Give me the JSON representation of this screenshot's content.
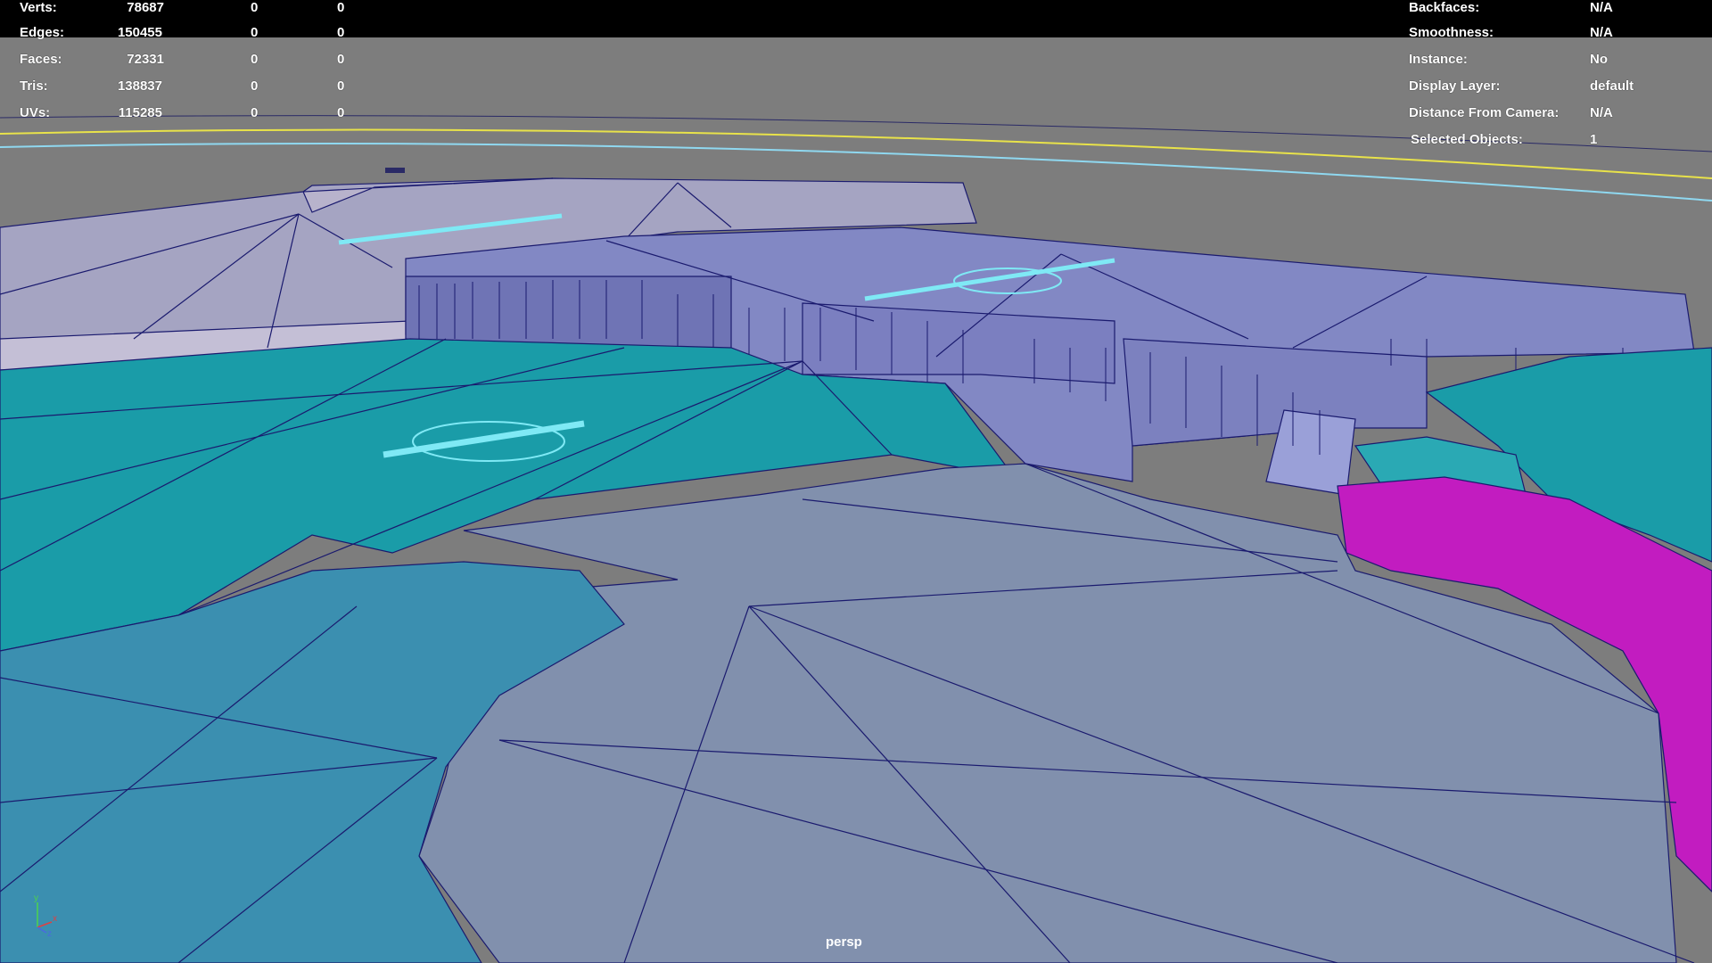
{
  "stats": [
    {
      "label": "Verts:",
      "total": "78687",
      "selected": "0",
      "extra": "0"
    },
    {
      "label": "Edges:",
      "total": "150455",
      "selected": "0",
      "extra": "0"
    },
    {
      "label": "Faces:",
      "total": "72331",
      "selected": "0",
      "extra": "0"
    },
    {
      "label": "Tris:",
      "total": "138837",
      "selected": "0",
      "extra": "0"
    },
    {
      "label": "UVs:",
      "total": "115285",
      "selected": "0",
      "extra": "0"
    }
  ],
  "object_info": [
    {
      "label": "Backfaces:",
      "value": "N/A"
    },
    {
      "label": "Smoothness:",
      "value": "N/A"
    },
    {
      "label": "Instance:",
      "value": "No"
    },
    {
      "label": "Display Layer:",
      "value": "default"
    },
    {
      "label": "Distance From Camera:",
      "value": "N/A"
    },
    {
      "label": "Selected Objects:",
      "value": "1"
    }
  ],
  "camera_name": "persp",
  "axis_labels": {
    "y": "y",
    "x": "x",
    "z": "z"
  },
  "colors": {
    "background": "#7d7d7d",
    "wire": "#1a1a6e",
    "teal": "#1a9ca8",
    "slate": "#8190ad",
    "lavender": "#a5a4c2",
    "blue": "#8288c4",
    "cyan_blue": "#3b8fb0",
    "magenta": "#c21cc0",
    "highlight_cyan": "#7fe9f5",
    "horizon_yellow": "#e8e24a",
    "horizon_cyan": "#8fd8f0"
  }
}
